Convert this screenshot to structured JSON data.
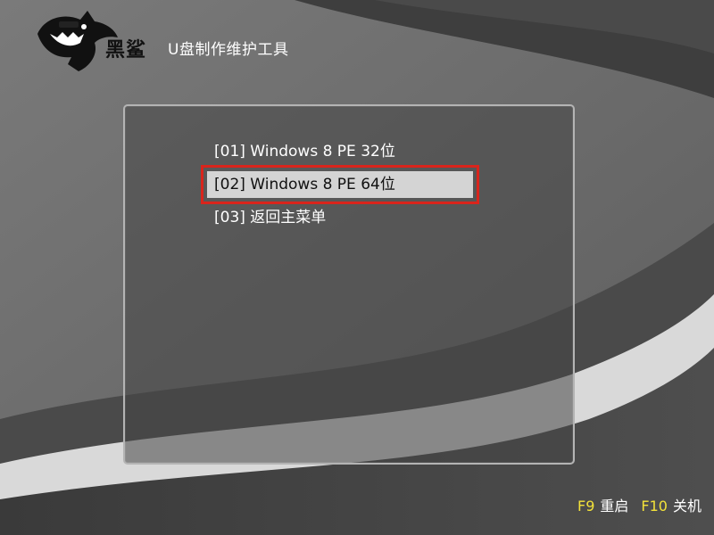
{
  "header": {
    "brand": "黑鲨",
    "title": "U盘制作维护工具"
  },
  "menu": {
    "items": [
      {
        "label": "[01] Windows 8 PE 32位",
        "selected": false
      },
      {
        "label": "[02] Windows 8 PE 64位",
        "selected": true
      },
      {
        "label": "[03] 返回主菜单",
        "selected": false
      }
    ]
  },
  "footer": {
    "restart_key": "F9",
    "restart_label": "重启",
    "shutdown_key": "F10",
    "shutdown_label": "关机"
  },
  "colors": {
    "highlight_border": "#d9241c",
    "selected_bg": "#d4d4d4",
    "hotkey": "#f3e23a"
  },
  "icons": [
    "shark-logo-icon"
  ]
}
